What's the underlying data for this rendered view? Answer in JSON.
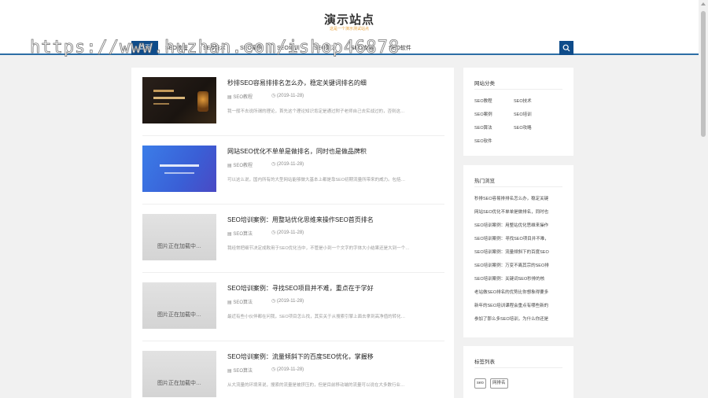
{
  "site": {
    "title": "演示站点",
    "subtitle": "这是一个演示测试站点"
  },
  "nav": {
    "items": [
      {
        "label": "首页"
      },
      {
        "label": "SEO教程"
      },
      {
        "label": "SEO技术"
      },
      {
        "label": "SEO案例"
      },
      {
        "label": "SEO培训"
      },
      {
        "label": "SEO算法"
      },
      {
        "label": "SEO攻略"
      },
      {
        "label": "SEO软件"
      }
    ],
    "search_icon": "search-icon"
  },
  "watermark": "https://www.huzhan.com/ishop46878",
  "articles": [
    {
      "title": "秒排SEO容易排排名怎么办，稳定关键词排名的细",
      "category": "SEO教程",
      "date": "(2019-11-28)",
      "excerpt": "我一般不去说所谓的理论，首先这个理论知识肯定是通过附子老师自己去实战过的，否则这…",
      "thumb_text": ""
    },
    {
      "title": "网站SEO优化不单单是做排名，同时也是做品牌积",
      "category": "SEO教程",
      "date": "(2019-11-28)",
      "excerpt": "可以这么说，国内所有的大型网站能够做大基本上都是靠SEO初期流量所带来的威力。包括…",
      "thumb_text": ""
    },
    {
      "title": "SEO培训案例：用整站优化思维来操作SEO首页排名",
      "category": "SEO算法",
      "date": "(2019-11-28)",
      "excerpt": "我经常把细节决定成败用于SEO优化当中，不管是小到一个文字的字体大小结果还是大到一个…",
      "thumb_text": "图片正在加载中…"
    },
    {
      "title": "SEO培训案例：寻找SEO项目并不难，重点在于学好",
      "category": "SEO算法",
      "date": "(2019-11-28)",
      "excerpt": "最近有些小伙伴都在问我，SEO项目怎么找，其实关于从搜索引擎上面去拿到高净值的转化…",
      "thumb_text": "图片正在加载中…"
    },
    {
      "title": "SEO培训案例：流量倾斜下的百度SEO优化，掌握移",
      "category": "SEO算法",
      "date": "(2019-11-28)",
      "excerpt": "从大流量的环境来说，搜索的流量是被挤压的，但是目前移动端的流量可以说在大多数行业…",
      "thumb_text": "图片正在加载中…"
    }
  ],
  "sidebar": {
    "categories": {
      "title": "网站分类",
      "items": [
        "SEO教程",
        "SEO技术",
        "SEO案例",
        "SEO培训",
        "SEO算法",
        "SEO攻略",
        "SEO软件"
      ]
    },
    "hot": {
      "title": "热门浏览",
      "items": [
        "秒排SEO容易排排名怎么办，稳定关键",
        "网站SEO优化不单单是做排名，同时也",
        "SEO培训案例：用整站优化思维来操作",
        "SEO培训案例：寻找SEO项目并不难，",
        "SEO培训案例：流量倾斜下的百度SEO",
        "SEO培训案例：万变不离其宗的SEO排",
        "SEO培训案例：关键词SEO秒排的核",
        "老站做SEO排名的优势比你想象得要多",
        "新年的SEO培训课程会重点有哪些新的",
        "参加了那么多SEO培训，为什么你还是"
      ]
    },
    "tags": {
      "title": "标签列表",
      "items": [
        "seo",
        "网排名"
      ]
    }
  },
  "icons": {
    "category": "folder-icon",
    "date": "clock-icon"
  }
}
